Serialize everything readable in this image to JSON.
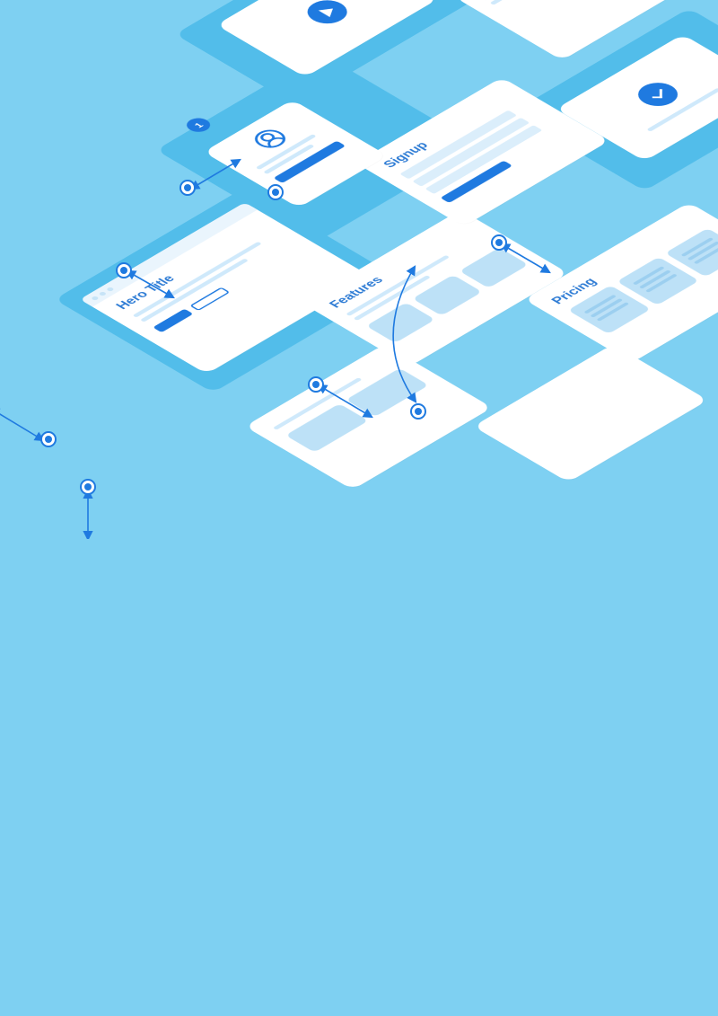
{
  "badge_number": "1",
  "screens": {
    "hero": {
      "title": "Hero Title"
    },
    "features": {
      "title": "Features"
    },
    "pricing": {
      "title": "Pricing"
    },
    "signup": {
      "title": "Signup"
    }
  },
  "icons": {
    "profile": "avatar-icon",
    "video": "play-icon",
    "success": "check-icon"
  },
  "colors": {
    "bg": "#7ed0f2",
    "plate": "#52bdea",
    "accent": "#1f7ae0",
    "card": "#ffffff",
    "muted": "#cfe9fb"
  }
}
